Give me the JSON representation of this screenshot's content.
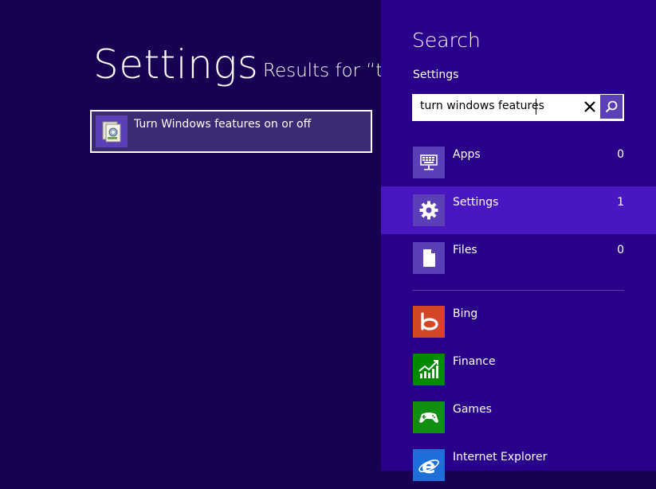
{
  "main": {
    "title": "Settings",
    "results_for": "Results for “tu",
    "results": [
      {
        "label": "Turn Windows features on or off",
        "icon": "windows-features-icon"
      }
    ]
  },
  "charm": {
    "title": "Search",
    "scope_label": "Settings",
    "search": {
      "value": "turn windows features",
      "placeholder": ""
    },
    "scopes": [
      {
        "name": "Apps",
        "count": "0",
        "icon": "keyboard-monitor-icon",
        "selected": false
      },
      {
        "name": "Settings",
        "count": "1",
        "icon": "gear-icon",
        "selected": true
      },
      {
        "name": "Files",
        "count": "0",
        "icon": "file-icon",
        "selected": false
      }
    ],
    "apps": [
      {
        "name": "Bing",
        "icon": "bing-icon",
        "color": "#d34727"
      },
      {
        "name": "Finance",
        "icon": "finance-icon",
        "color": "#008a00"
      },
      {
        "name": "Games",
        "icon": "games-controller-icon",
        "color": "#108f10"
      },
      {
        "name": "Internet Explorer",
        "icon": "internet-explorer-icon",
        "color": "#1e6fd9"
      }
    ]
  },
  "colors": {
    "background": "#180052",
    "charm_background": "#28008a",
    "selected_scope": "#4817c2",
    "tile_purple": "#5b3fb6"
  }
}
